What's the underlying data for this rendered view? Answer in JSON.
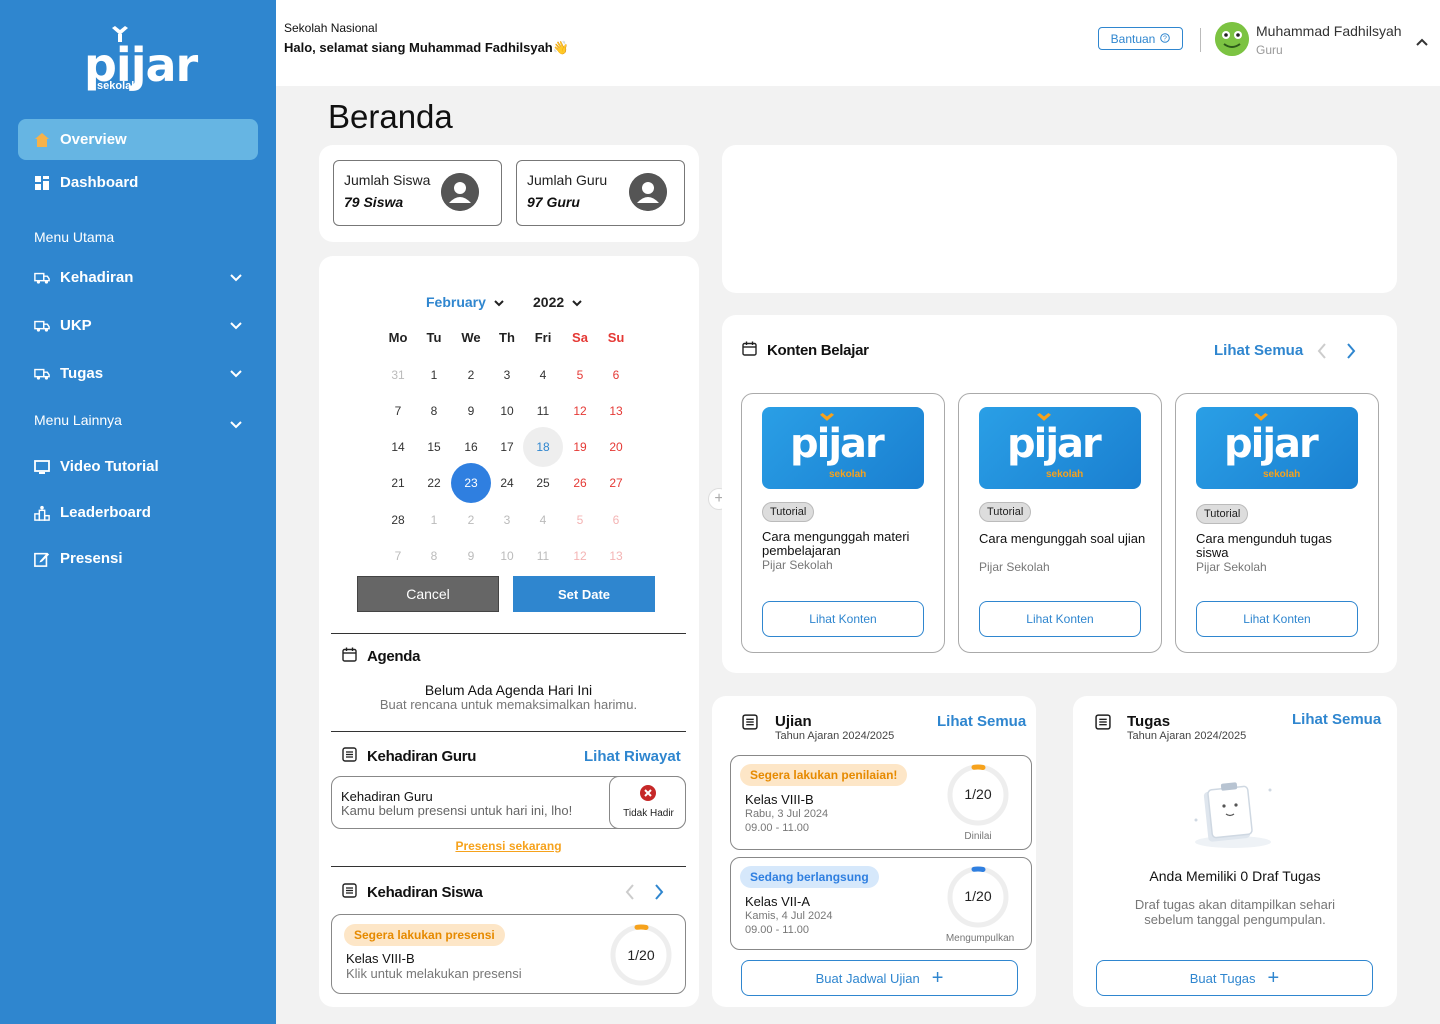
{
  "brand": {
    "logo_word": "pijar",
    "logo_sub": "sekolah"
  },
  "sidebar": {
    "overview": "Overview",
    "dashboard": "Dashboard",
    "menu_utama": "Menu Utama",
    "kehadiran": "Kehadiran",
    "ukp": "UKP",
    "tugas": "Tugas",
    "menu_lainnya": "Menu Lainnya",
    "video_tutorial": "Video Tutorial",
    "leaderboard": "Leaderboard",
    "presensi": "Presensi"
  },
  "header": {
    "school": "Sekolah Nasional",
    "greeting": "Halo, selamat siang Muhammad Fadhilsyah👋",
    "help": "Bantuan",
    "user_name": "Muhammad Fadhilsyah",
    "user_role": "Guru"
  },
  "page": {
    "title": "Beranda"
  },
  "stats": {
    "siswa_label": "Jumlah Siswa",
    "siswa_value": "79 Siswa",
    "guru_label": "Jumlah Guru",
    "guru_value": "97 Guru"
  },
  "calendar": {
    "month": "February",
    "year": "2022",
    "weekdays": [
      "Mo",
      "Tu",
      "We",
      "Th",
      "Fri",
      "Sa",
      "Su"
    ],
    "rows": [
      [
        "31",
        "1",
        "2",
        "3",
        "4",
        "5",
        "6"
      ],
      [
        "7",
        "8",
        "9",
        "10",
        "11",
        "12",
        "13"
      ],
      [
        "14",
        "15",
        "16",
        "17",
        "18",
        "19",
        "20"
      ],
      [
        "21",
        "22",
        "23",
        "24",
        "25",
        "26",
        "27"
      ],
      [
        "28",
        "1",
        "2",
        "3",
        "4",
        "5",
        "6"
      ],
      [
        "7",
        "8",
        "9",
        "10",
        "11",
        "12",
        "13"
      ]
    ],
    "today": "18",
    "selected": "23",
    "cancel": "Cancel",
    "set_date": "Set Date"
  },
  "agenda": {
    "title": "Agenda",
    "empty_title": "Belum Ada Agenda Hari Ini",
    "empty_sub": "Buat rencana untuk memaksimalkan harimu."
  },
  "kehadiran_guru": {
    "title": "Kehadiran Guru",
    "link": "Lihat Riwayat",
    "box_title": "Kehadiran Guru",
    "box_sub": "Kamu belum presensi untuk hari ini, lho!",
    "status": "Tidak Hadir",
    "action": "Presensi sekarang"
  },
  "kehadiran_siswa": {
    "title": "Kehadiran Siswa",
    "badge": "Segera lakukan presensi",
    "class": "Kelas VIII-B",
    "sub": "Klik untuk melakukan presensi",
    "progress": "1/20"
  },
  "konten": {
    "title": "Konten Belajar",
    "link": "Lihat Semua",
    "items": [
      {
        "tag": "Tutorial",
        "title": "Cara mengunggah  materi pembelajaran",
        "source": "Pijar Sekolah",
        "button": "Lihat Konten"
      },
      {
        "tag": "Tutorial",
        "title": "Cara mengunggah soal ujian",
        "source": "Pijar Sekolah",
        "button": "Lihat Konten"
      },
      {
        "tag": "Tutorial",
        "title": "Cara mengunduh tugas siswa",
        "source": "Pijar Sekolah",
        "button": "Lihat Konten"
      }
    ]
  },
  "ujian": {
    "title": "Ujian",
    "year": "Tahun Ajaran 2024/2025",
    "link": "Lihat Semua",
    "items": [
      {
        "badge": "Segera lakukan penilaian!",
        "class": "Kelas VIII-B",
        "date": "Rabu, 3 Jul 2024",
        "time": "09.00 - 11.00",
        "progress": "1/20",
        "status": "Dinilai"
      },
      {
        "badge": "Sedang berlangsung",
        "class": "Kelas VII-A",
        "date": "Kamis, 4 Jul 2024",
        "time": "09.00 - 11.00",
        "progress": "1/20",
        "status": "Mengumpulkan"
      }
    ],
    "button": "Buat Jadwal Ujian"
  },
  "tugas": {
    "title": "Tugas",
    "year": "Tahun Ajaran 2024/2025",
    "link": "Lihat Semua",
    "empty_title": "Anda Memiliki 0 Draf Tugas",
    "empty_sub": "Draf tugas akan ditampilkan sehari sebelum tanggal pengumpulan.",
    "button": "Buat Tugas"
  },
  "colors": {
    "primary": "#2f86cf",
    "sidebar": "#2f86cf",
    "accent_orange": "#f6a21c",
    "weekend_red": "#e53935"
  }
}
